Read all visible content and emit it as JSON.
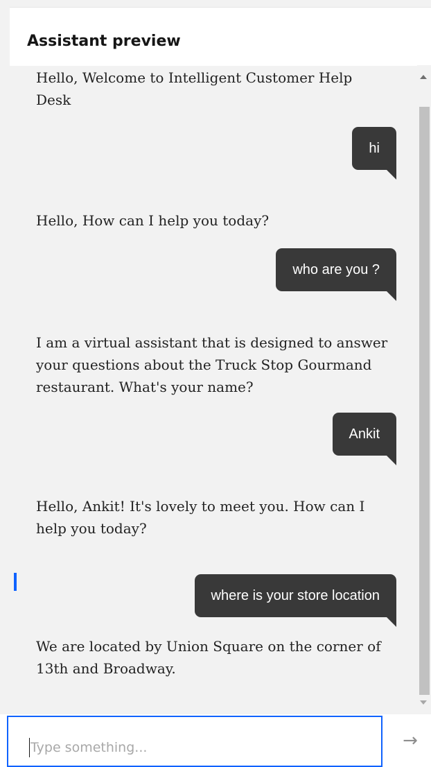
{
  "header": {
    "title": "Assistant preview"
  },
  "messages": [
    {
      "role": "bot",
      "text": "Hello, Welcome to Intelligent Customer Help Desk"
    },
    {
      "role": "user",
      "text": "hi"
    },
    {
      "role": "bot",
      "text": "Hello, How can I help you today?"
    },
    {
      "role": "user",
      "text": "who are you ?"
    },
    {
      "role": "bot",
      "text": "I am a virtual assistant that is designed to answer your questions about the Truck Stop Gourmand restaurant. What's your name?"
    },
    {
      "role": "user",
      "text": "Ankit"
    },
    {
      "role": "bot",
      "text": "Hello, Ankit! It's lovely to meet you. How can I help you today?"
    },
    {
      "role": "user",
      "text": "where is your store location"
    },
    {
      "role": "bot",
      "text": "We are located by Union Square on the corner of 13th and Broadway."
    }
  ],
  "input": {
    "placeholder": "Type something...",
    "value": ""
  },
  "send": {
    "icon": "arrow-right-icon",
    "glyph": "→"
  },
  "colors": {
    "user_bubble": "#393939",
    "accent": "#0f62fe",
    "background": "#f2f2f2"
  }
}
